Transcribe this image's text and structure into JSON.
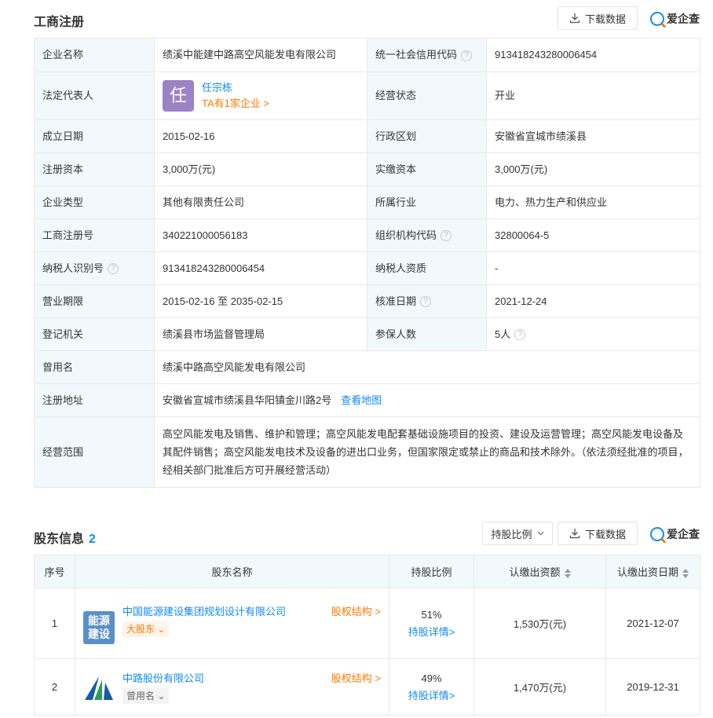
{
  "registration": {
    "title": "工商注册",
    "download_label": "下载数据",
    "brand": "爱企查",
    "rows": {
      "company_name": {
        "key": "企业名称",
        "value": "绩溪中能建中路高空风能发电有限公司"
      },
      "credit_code": {
        "key": "统一社会信用代码",
        "value": "913418243280006454"
      },
      "legal_rep": {
        "key": "法定代表人",
        "avatar_char": "任",
        "name": "任宗栋",
        "sub": "TA有1家企业 >"
      },
      "status": {
        "key": "经营状态",
        "value": "开业"
      },
      "found_date": {
        "key": "成立日期",
        "value": "2015-02-16"
      },
      "district": {
        "key": "行政区划",
        "value": "安徽省宣城市绩溪县"
      },
      "reg_capital": {
        "key": "注册资本",
        "value": "3,000万(元)"
      },
      "paid_capital": {
        "key": "实缴资本",
        "value": "3,000万(元)"
      },
      "type": {
        "key": "企业类型",
        "value": "其他有限责任公司"
      },
      "industry": {
        "key": "所属行业",
        "value": "电力、热力生产和供应业"
      },
      "reg_no": {
        "key": "工商注册号",
        "value": "340221000056183"
      },
      "org_code": {
        "key": "组织机构代码",
        "value": "32800064-5"
      },
      "taxpayer_id": {
        "key": "纳税人识别号",
        "value": "913418243280006454"
      },
      "taxpayer_qual": {
        "key": "纳税人资质",
        "value": "-"
      },
      "term": {
        "key": "营业期限",
        "value": "2015-02-16 至 2035-02-15"
      },
      "approve_date": {
        "key": "核准日期",
        "value": "2021-12-24"
      },
      "authority": {
        "key": "登记机关",
        "value": "绩溪县市场监督管理局"
      },
      "insured": {
        "key": "参保人数",
        "value": "5人"
      },
      "former_name": {
        "key": "曾用名",
        "value": "绩溪中路高空风能发电有限公司"
      },
      "address": {
        "key": "注册地址",
        "value": "安徽省宣城市绩溪县华阳镇金川路2号",
        "link": "查看地图"
      },
      "scope": {
        "key": "经营范围",
        "value": "高空风能发电及销售、维护和管理；高空风能发电配套基础设施项目的投资、建设及运营管理；高空风能发电设备及其配件销售；高空风能发电技术及设备的进出口业务，但国家限定或禁止的商品和技术除外。（依法须经批准的项目，经相关部门批准后方可开展经营活动）"
      }
    }
  },
  "shareholders": {
    "title": "股东信息",
    "count": "2",
    "filter_label": "持股比例",
    "download_label": "下载数据",
    "brand": "爱企查",
    "columns": [
      "序号",
      "股东名称",
      "持股比例",
      "认缴出资额",
      "认缴出资日期"
    ],
    "rows": [
      {
        "no": "1",
        "logo_text": "能源建设",
        "name": "中国能源建设集团规划设计有限公司",
        "tag": "大股东",
        "equity_link": "股权结构 >",
        "ratio": "51%",
        "detail": "持股详情>",
        "amount": "1,530万(元)",
        "date": "2021-12-07"
      },
      {
        "no": "2",
        "name": "中路股份有限公司",
        "tag": "曾用名",
        "equity_link": "股权结构 >",
        "ratio": "49%",
        "detail": "持股详情>",
        "amount": "1,470万(元)",
        "date": "2019-12-31"
      }
    ]
  },
  "colors": {
    "accent": "#128bed",
    "orange": "#ff7a00",
    "key_bg": "#f2f9fc"
  }
}
